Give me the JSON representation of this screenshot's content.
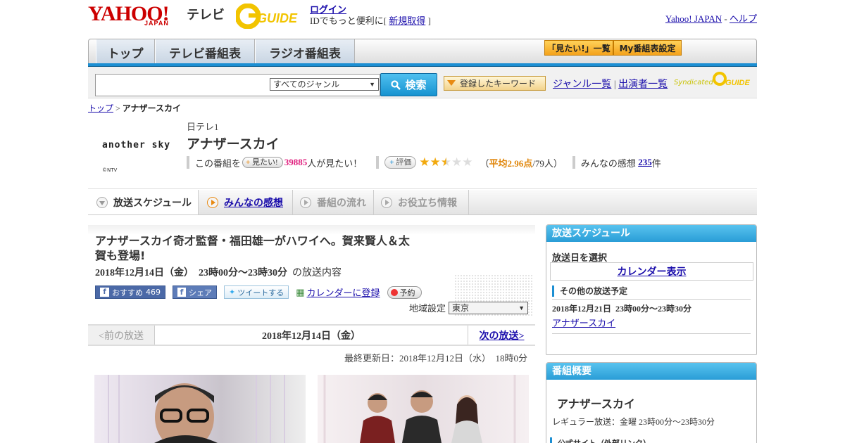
{
  "header": {
    "logo_yahoo": "YAHOO!",
    "logo_japan": "JAPAN",
    "logo_tv": "テレビ",
    "gguide_text": "GUIDE",
    "login_label": "ログイン",
    "login_desc_prefix": "IDでもっと便利に[",
    "register_label": "新規取得",
    "login_desc_suffix": "]",
    "yahoo_japan_link": "Yahoo! JAPAN",
    "sep": "-",
    "help_link": "ヘルプ"
  },
  "nav": {
    "tabs": [
      "トップ",
      "テレビ番組表",
      "ラジオ番組表"
    ],
    "mitai_list": "「見たい!」一覧",
    "my_schedule": "My番組表設定"
  },
  "search": {
    "genre_value": "すべてのジャンル",
    "search_button": "検索",
    "keyword_button": "登録したキーワード",
    "genre_list_link": "ジャンル一覧",
    "divider": "|",
    "performer_list_link": "出演者一覧",
    "syndicated": "Syndicated",
    "gguide_small": "GUIDE"
  },
  "breadcrumb": {
    "top": "トップ",
    "sep": ">",
    "current": "アナザースカイ"
  },
  "program": {
    "logo_text": "another sky",
    "copyright": "©NTV",
    "station": "日テレ1",
    "title": "アナザースカイ",
    "mitai_prefix": "この番組を",
    "mitai_button": "見たい!",
    "mitai_count": "39885",
    "mitai_suffix": "人が見たい！",
    "rating_button": "評価",
    "rating_value": 2.96,
    "rating_open": "（",
    "rating_avg": "平均2.96点",
    "rating_count": "/79人）",
    "impressions_prefix": "みんなの感想",
    "impressions_count": "235",
    "impressions_suffix": "件"
  },
  "subtabs": [
    "放送スケジュール",
    "みんなの感想",
    "番組の流れ",
    "お役立ち情報"
  ],
  "episode": {
    "title": "アナザースカイ奇才監督・福田雄一がハワイへ。賀来賢人＆太賀も登場!",
    "date": "2018年12月14日（金）",
    "time": "23時00分～23時30分",
    "date_suffix": "の放送内容",
    "fb_recommend": "おすすめ",
    "fb_count": "469",
    "fb_share": "シェア",
    "tweet": "ツイートする",
    "calendar_register": "カレンダーに登録",
    "reserve": "予約",
    "region_label": "地域設定",
    "region_value": "東京"
  },
  "pager": {
    "prev": "<前の放送",
    "current": "2018年12月14日（金）",
    "next": "次の放送>"
  },
  "updated": "最終更新日：2018年12月12日（水）　18時0分",
  "sidebar": {
    "schedule_title": "放送スケジュール",
    "select_date": "放送日を選択",
    "calendar_view": "カレンダー表示",
    "other_broadcasts": "その他の放送予定",
    "next_date": "2018年12月21日",
    "next_time": "23時00分～23時30分",
    "next_program": "アナザースカイ",
    "overview_title": "番組概要",
    "overview_program": "アナザースカイ",
    "regular": "レギュラー放送：金曜 23時00分～23時30分",
    "official_site": "公式サイト（外部リンク）"
  },
  "colors": {
    "accent_blue": "#1c8fd3",
    "yahoo_red": "#cc0000",
    "pink": "#e0207e",
    "star": "#f2a90d"
  }
}
